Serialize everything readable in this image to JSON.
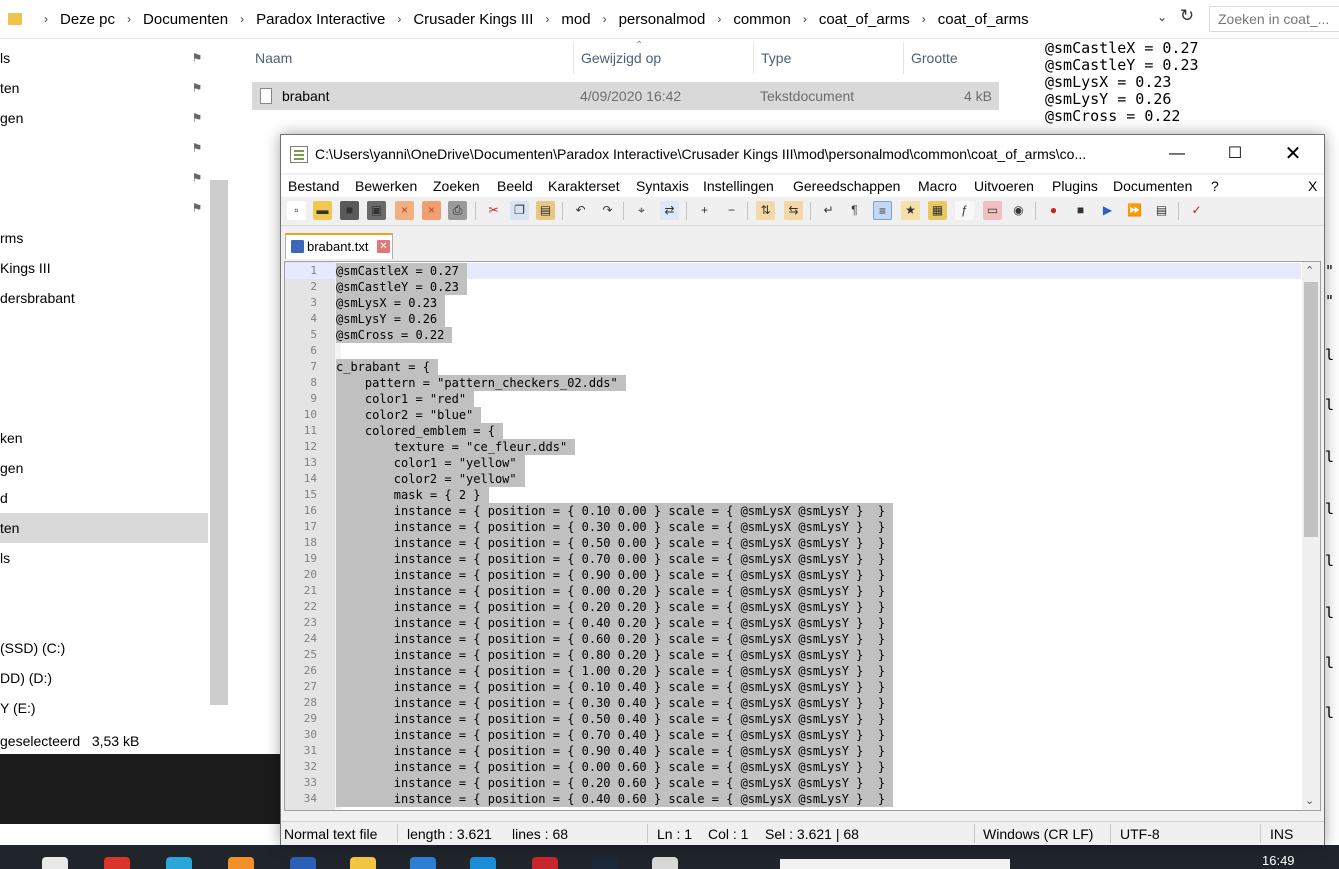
{
  "explorer": {
    "breadcrumb": [
      "Deze pc",
      "Documenten",
      "Paradox Interactive",
      "Crusader Kings III",
      "mod",
      "personalmod",
      "common",
      "coat_of_arms",
      "coat_of_arms"
    ],
    "search_placeholder": "Zoeken in coat_...",
    "nav_items": [
      "ls",
      "ten",
      "gen",
      "",
      "",
      "",
      "rms",
      "Kings III",
      "dersbrabant",
      "ken",
      "gen",
      "d",
      "ten",
      "ls",
      "(SSD) (C:)",
      "DD) (D:)",
      "Y (E:)"
    ],
    "columns": [
      "Naam",
      "Gewijzigd op",
      "Type",
      "Grootte"
    ],
    "file": {
      "name": "brabant",
      "modified": "4/09/2020 16:42",
      "type": "Tekstdocument",
      "size": "4 kB"
    },
    "status_selected": "geselecteerd",
    "status_size": "3,53 kB",
    "preview_lines": [
      "@smCastleX = 0.27",
      "@smCastleY = 0.23",
      "@smLysX = 0.23",
      "@smLysY = 0.26",
      "@smCross = 0.22"
    ],
    "taskbar_clock": "16:49"
  },
  "npp": {
    "title": "C:\\Users\\yanni\\OneDrive\\Documenten\\Paradox Interactive\\Crusader Kings III\\mod\\personalmod\\common\\coat_of_arms\\co...",
    "menu": [
      "Bestand",
      "Bewerken",
      "Zoeken",
      "Beeld",
      "Karakterset",
      "Syntaxis",
      "Instellingen",
      "Gereedschappen",
      "Macro",
      "Uitvoeren",
      "Plugins",
      "Documenten",
      "?"
    ],
    "menu_close": "X",
    "tab_label": "brabant.txt",
    "toolbar_icons": [
      "new-file-icon",
      "open-file-icon",
      "save-icon",
      "save-all-icon",
      "close-icon",
      "close-all-icon",
      "print-icon",
      "cut-icon",
      "copy-icon",
      "paste-icon",
      "undo-icon",
      "redo-icon",
      "find-icon",
      "replace-icon",
      "zoom-in-icon",
      "zoom-out-icon",
      "sync-vertical-icon",
      "sync-horizontal-icon",
      "word-wrap-icon",
      "show-all-chars-icon",
      "indent-guide-icon",
      "user-lang-icon",
      "doc-map-icon",
      "function-list-icon",
      "folder-workspace-icon",
      "monitor-icon",
      "record-macro-icon",
      "stop-macro-icon",
      "play-macro-icon",
      "run-macro-multiple-icon",
      "save-macro-icon",
      "spellcheck-icon"
    ],
    "lines": [
      "@smCastleX = 0.27",
      "@smCastleY = 0.23",
      "@smLysX = 0.23",
      "@smLysY = 0.26",
      "@smCross = 0.22",
      "",
      "c_brabant = {",
      "    pattern = \"pattern_checkers_02.dds\"",
      "    color1 = \"red\"",
      "    color2 = \"blue\"",
      "    colored_emblem = {",
      "        texture = \"ce_fleur.dds\"",
      "        color1 = \"yellow\"",
      "        color2 = \"yellow\"",
      "        mask = { 2 }",
      "        instance = { position = { 0.10 0.00 } scale = { @smLysX @smLysY }  }",
      "        instance = { position = { 0.30 0.00 } scale = { @smLysX @smLysY }  }",
      "        instance = { position = { 0.50 0.00 } scale = { @smLysX @smLysY }  }",
      "        instance = { position = { 0.70 0.00 } scale = { @smLysX @smLysY }  }",
      "        instance = { position = { 0.90 0.00 } scale = { @smLysX @smLysY }  }",
      "        instance = { position = { 0.00 0.20 } scale = { @smLysX @smLysY }  }",
      "        instance = { position = { 0.20 0.20 } scale = { @smLysX @smLysY }  }",
      "        instance = { position = { 0.40 0.20 } scale = { @smLysX @smLysY }  }",
      "        instance = { position = { 0.60 0.20 } scale = { @smLysX @smLysY }  }",
      "        instance = { position = { 0.80 0.20 } scale = { @smLysX @smLysY }  }",
      "        instance = { position = { 1.00 0.20 } scale = { @smLysX @smLysY }  }",
      "        instance = { position = { 0.10 0.40 } scale = { @smLysX @smLysY }  }",
      "        instance = { position = { 0.30 0.40 } scale = { @smLysX @smLysY }  }",
      "        instance = { position = { 0.50 0.40 } scale = { @smLysX @smLysY }  }",
      "        instance = { position = { 0.70 0.40 } scale = { @smLysX @smLysY }  }",
      "        instance = { position = { 0.90 0.40 } scale = { @smLysX @smLysY }  }",
      "        instance = { position = { 0.00 0.60 } scale = { @smLysX @smLysY }  }",
      "        instance = { position = { 0.20 0.60 } scale = { @smLysX @smLysY }  }",
      "        instance = { position = { 0.40 0.60 } scale = { @smLysX @smLysY }  }"
    ],
    "status": {
      "file_type": "Normal text file",
      "length": "length : 3.621",
      "lines": "lines : 68",
      "ln": "Ln : 1",
      "col": "Col : 1",
      "sel": "Sel : 3.621 | 68",
      "eol": "Windows (CR LF)",
      "encoding": "UTF-8",
      "mode": "INS"
    }
  },
  "colors": {
    "selection": "#c0c0c0",
    "current_line": "#e8e8ff",
    "gutter": "#e4e4e4",
    "taskbar": "#20252c"
  }
}
